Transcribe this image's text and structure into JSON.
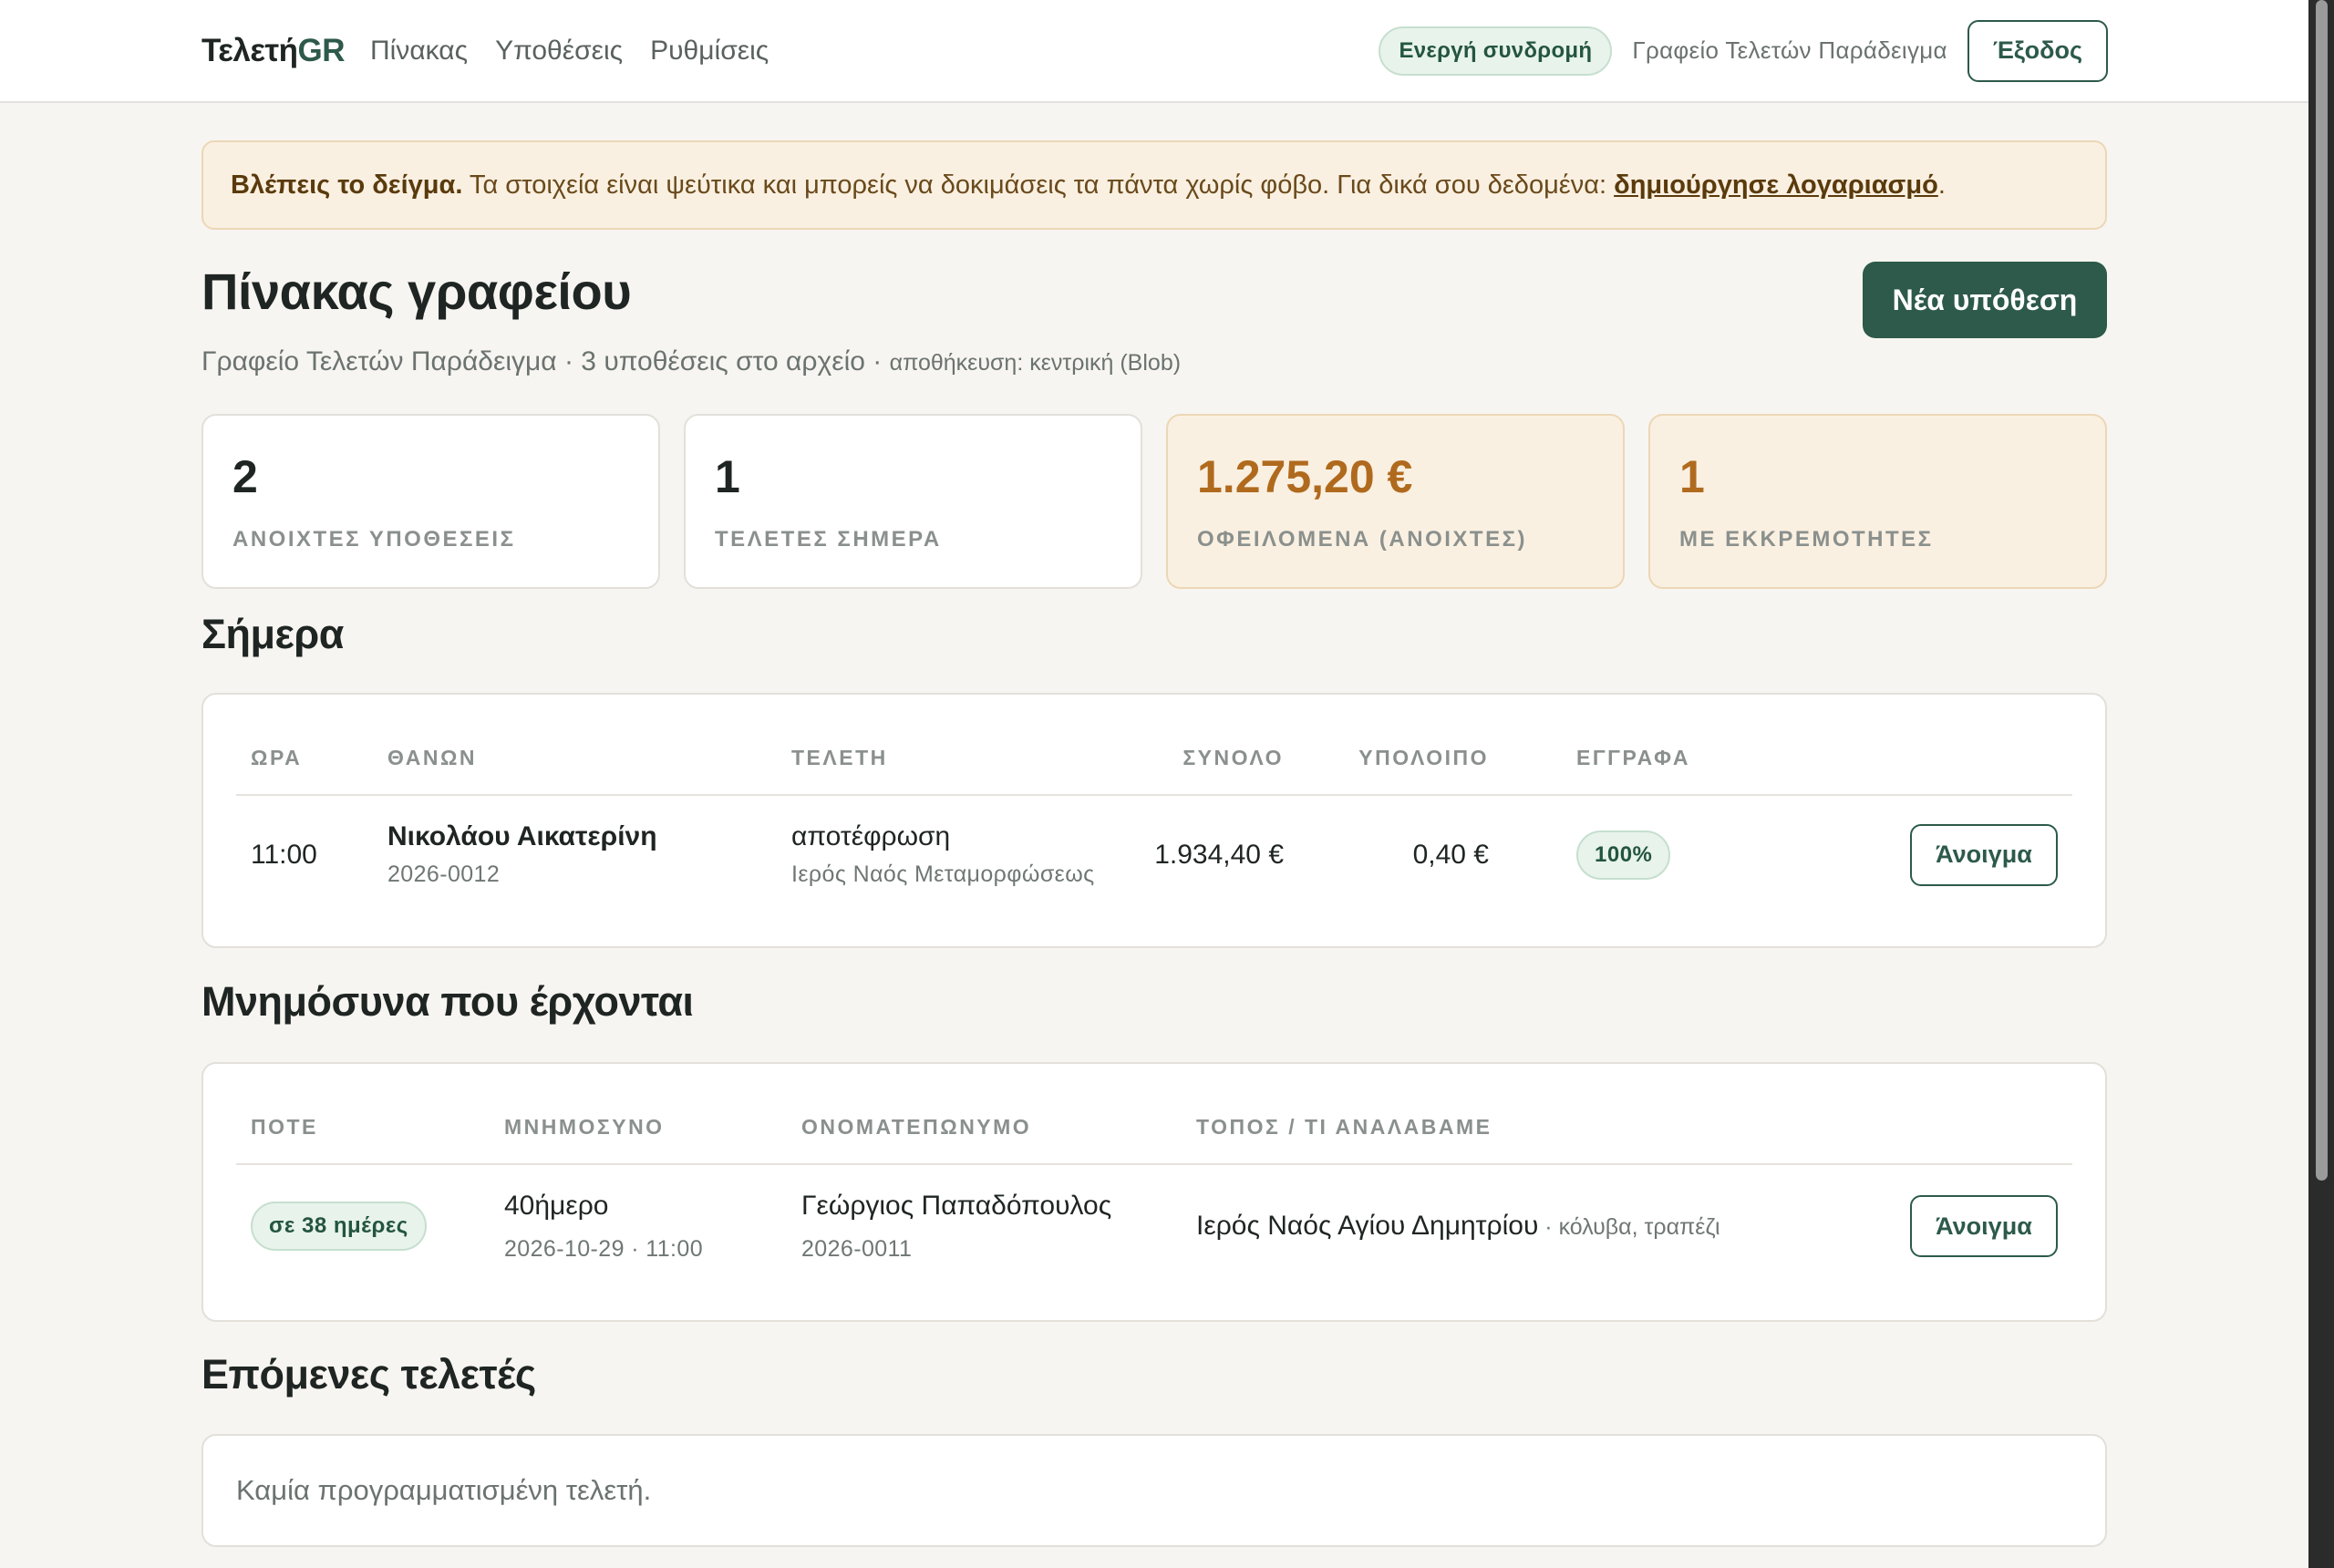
{
  "header": {
    "brand_main": "Τελετή",
    "brand_accent": "GR",
    "nav": [
      "Πίνακας",
      "Υποθέσεις",
      "Ρυθμίσεις"
    ],
    "subscription_badge": "Ενεργή συνδρομή",
    "office_name": "Γραφείο Τελετών Παράδειγμα",
    "logout_label": "Έξοδος"
  },
  "notice": {
    "bold": "Βλέπεις το δείγμα.",
    "text": " Τα στοιχεία είναι ψεύτικα και μπορείς να δοκιμάσεις τα πάντα χωρίς φόβο. Για δικά σου δεδομένα: ",
    "link": "δημιούργησε λογαριασμό",
    "end": "."
  },
  "page": {
    "title": "Πίνακας γραφείου",
    "subtitle": "Γραφείο Τελετών Παράδειγμα · 3 υποθέσεις στο αρχείο · ",
    "storage": "αποθήκευση: κεντρική (Blob)",
    "new_case_label": "Νέα υπόθεση"
  },
  "stats": [
    {
      "value": "2",
      "label": "ΑΝΟΙΧΤΕΣ ΥΠΟΘΕΣΕΙΣ"
    },
    {
      "value": "1",
      "label": "ΤΕΛΕΤΕΣ ΣΗΜΕΡΑ"
    },
    {
      "value": "1.275,20 €",
      "label": "ΟΦΕΙΛΟΜΕΝΑ (ΑΝΟΙΧΤΕΣ)"
    },
    {
      "value": "1",
      "label": "ΜΕ ΕΚΚΡΕΜΟΤΗΤΕΣ"
    }
  ],
  "today": {
    "heading": "Σήμερα",
    "columns": [
      "ΩΡΑ",
      "ΘΑΝΩΝ",
      "ΤΕΛΕΤΗ",
      "ΣΥΝΟΛΟ",
      "ΥΠΟΛΟΙΠΟ",
      "ΕΓΓΡΑΦΑ"
    ],
    "row": {
      "time": "11:00",
      "deceased": "Νικολάου Αικατερίνη",
      "case_no": "2026-0012",
      "ceremony": "αποτέφρωση",
      "place": "Ιερός Ναός Μεταμορφώσεως",
      "total": "1.934,40 €",
      "balance": "0,40 €",
      "documents": "100%",
      "open_label": "Άνοιγμα"
    }
  },
  "memorials": {
    "heading": "Μνημόσυνα που έρχονται",
    "columns": [
      "ΠΟΤΕ",
      "ΜΝΗΜΟΣΥΝΟ",
      "ΟΝΟΜΑΤΕΠΩΝΥΜΟ",
      "ΤΟΠΟΣ / ΤΙ ΑΝΑΛΑΒΑΜΕ"
    ],
    "row": {
      "when": "σε 38 ημέρες",
      "memorial": "40ήμερο",
      "datetime": "2026-10-29 · 11:00",
      "name": "Γεώργιος Παπαδόπουλος",
      "case_no": "2026-0011",
      "place": "Ιερός Ναός Αγίου Δημητρίου",
      "extras": " · κόλυβα, τραπέζι",
      "open_label": "Άνοιγμα"
    }
  },
  "upcoming": {
    "heading": "Επόμενες τελετές",
    "empty": "Καμία προγραμματισμένη τελετή."
  }
}
